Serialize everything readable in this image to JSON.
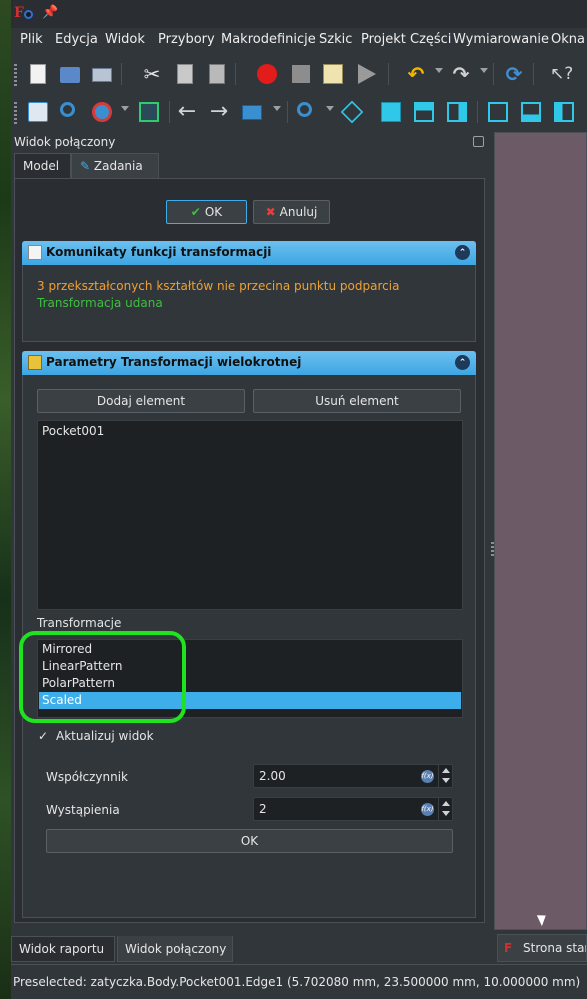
{
  "menu": [
    "Plik",
    "Edycja",
    "Widok",
    "Przybory",
    "Makrodefinicje",
    "Szkic",
    "Projekt Części",
    "Wymiarowanie",
    "Okna"
  ],
  "combo": {
    "title": "Widok połączony",
    "tabs": [
      "Model",
      "Zadania"
    ],
    "ok_label": "OK",
    "cancel_label": "Anuluj",
    "messages_box": {
      "title": "Komunikaty funkcji transformacji",
      "warning": "3 przekształconych kształtów nie przecina punktu podparcia",
      "success": "Transformacja udana"
    },
    "params_box": {
      "title": "Parametry Transformacji wielokrotnej",
      "add_label": "Dodaj element",
      "remove_label": "Usuń element",
      "features": [
        "Pocket001"
      ],
      "transformations_label": "Transformacje",
      "transformations": [
        "Mirrored",
        "LinearPattern",
        "PolarPattern",
        "Scaled"
      ],
      "selected_index": 3,
      "update_view_label": "Aktualizuj widok",
      "update_view_checked": true,
      "factor_label": "Współczynnik",
      "factor_value": "2.00",
      "occurrences_label": "Wystąpienia",
      "occurrences_value": "2",
      "ok_label": "OK"
    }
  },
  "bottom_tabs": [
    "Widok raportu",
    "Widok połączony"
  ],
  "view_tab_label": "Strona startowa",
  "status_text": "Preselected: zatyczka.Body.Pocket001.Edge1 (5.702080 mm, 23.500000 mm, 10.000000 mm)",
  "colors": {
    "accent": "#3daee9",
    "warning": "#f0a030",
    "success": "#3fbf3f",
    "highlight_ring": "#1fe31f",
    "viewport": "#6c5b67"
  },
  "icons": {
    "toolbar1": [
      "new-file-icon",
      "open-folder-icon",
      "save-icon",
      "cut-icon",
      "copy-icon",
      "paste-icon",
      "record-macro-icon",
      "stop-macro-icon",
      "edit-macro-icon",
      "run-macro-icon",
      "undo-icon",
      "redo-icon",
      "refresh-icon",
      "whats-this-icon"
    ],
    "toolbar2": [
      "fit-all-icon",
      "fit-selection-icon",
      "draw-style-icon",
      "bounding-box-icon",
      "back-icon",
      "forward-icon",
      "workbench-icon",
      "zoom-icon",
      "isometric-icon",
      "front-view-icon",
      "top-view-icon",
      "right-view-icon",
      "rear-view-icon",
      "bottom-view-icon",
      "left-view-icon"
    ]
  }
}
